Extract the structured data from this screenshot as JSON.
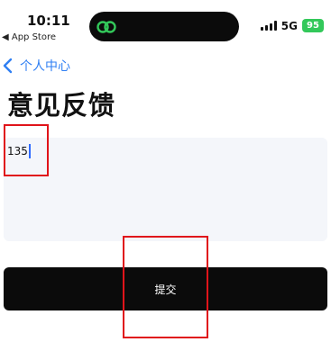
{
  "status_bar": {
    "time": "10:11",
    "back_app": "◀ App Store",
    "network": "5G",
    "battery": "95",
    "battery_color": "#33c85a"
  },
  "nav": {
    "back_label": "个人中心",
    "accent_color": "#2f7ff3"
  },
  "page": {
    "title": "意见反馈"
  },
  "feedback": {
    "value": "135"
  },
  "submit": {
    "label": "提交"
  },
  "highlight_color": "#e0141a"
}
